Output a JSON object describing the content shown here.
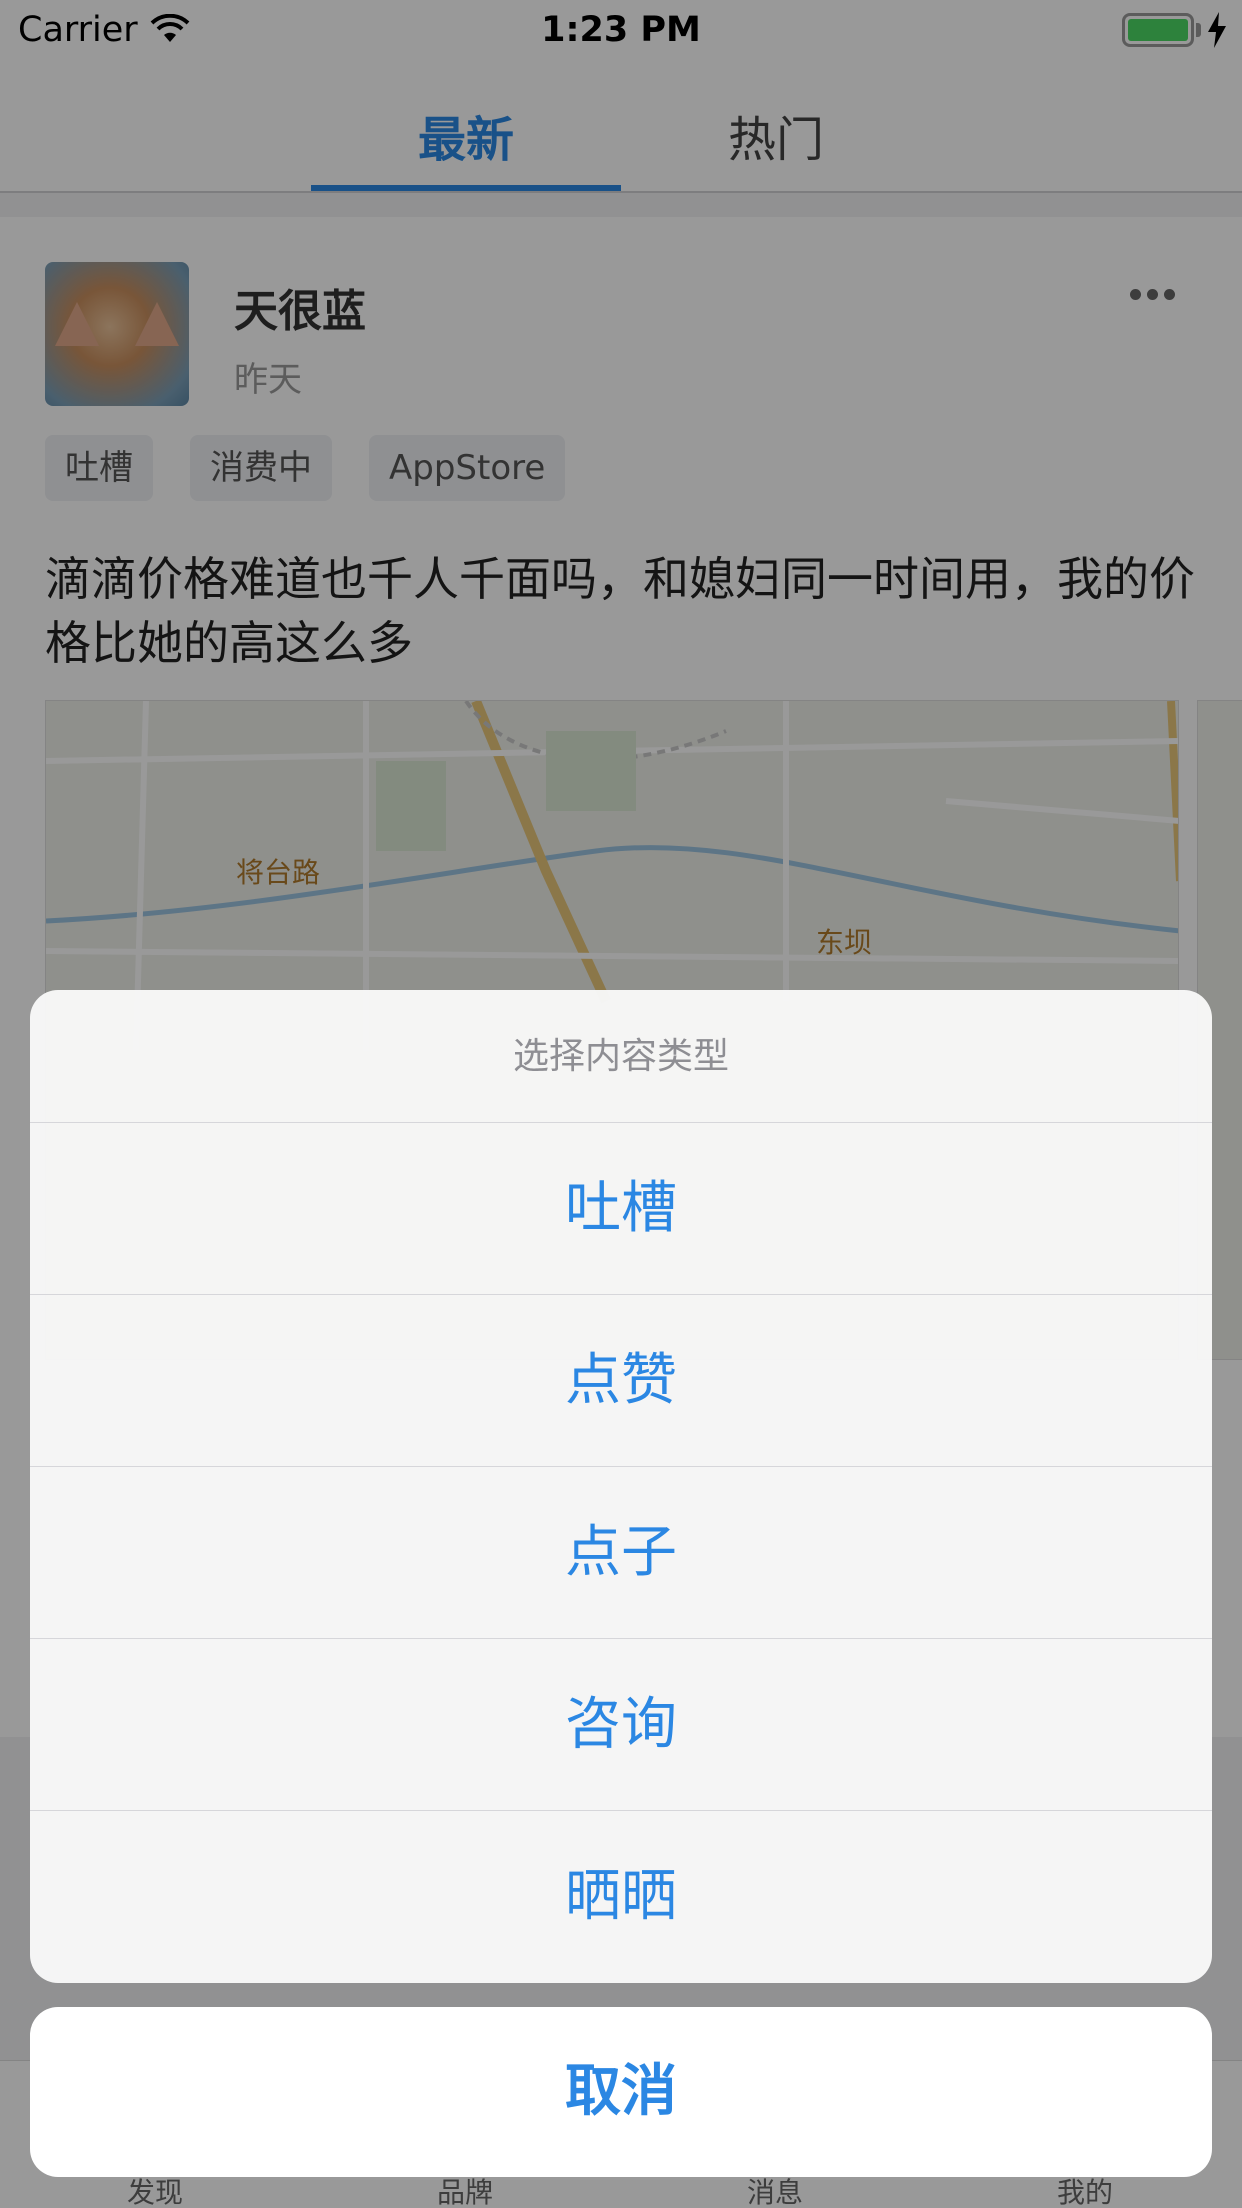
{
  "status_bar": {
    "carrier": "Carrier",
    "time": "1:23 PM"
  },
  "tabs": [
    {
      "label": "最新",
      "active": true
    },
    {
      "label": "热门",
      "active": false
    }
  ],
  "post": {
    "username": "天很蓝",
    "time": "昨天",
    "tags": [
      "吐槽",
      "消费中",
      "AppStore"
    ],
    "content": "滴滴价格难道也千人千面吗，和媳妇同一时间用，我的价格比她的高这么多",
    "map_labels": [
      "将台路",
      "东坝"
    ]
  },
  "bottom_nav": [
    "发现",
    "品牌",
    "消息",
    "我的"
  ],
  "action_sheet": {
    "title": "选择内容类型",
    "options": [
      "吐槽",
      "点赞",
      "点子",
      "咨询",
      "晒晒"
    ],
    "cancel": "取消"
  },
  "colors": {
    "accent": "#2b87e3",
    "battery": "#4cd964"
  }
}
